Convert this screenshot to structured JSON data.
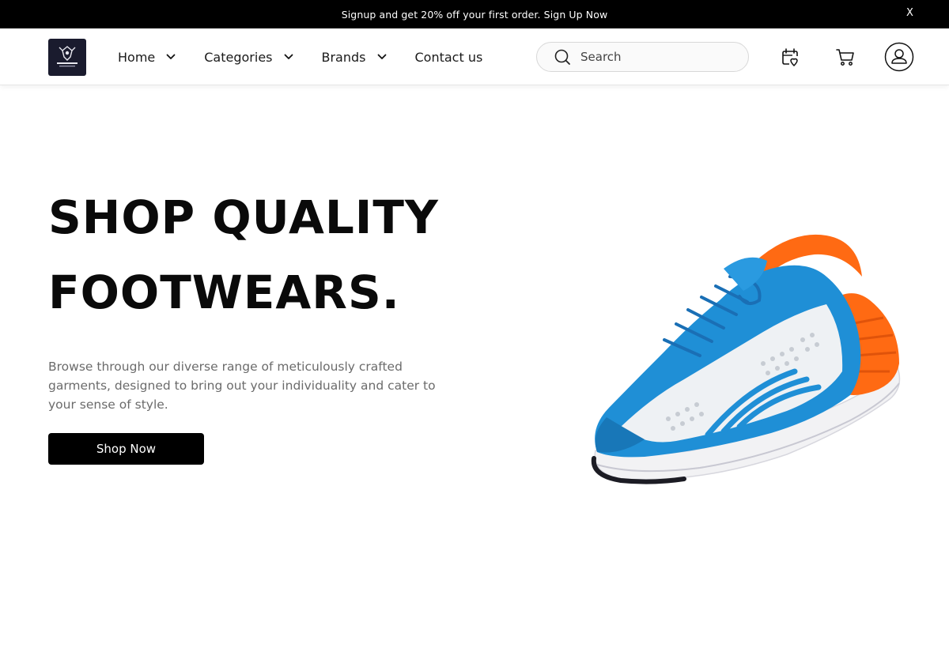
{
  "promo": {
    "text": "Signup and get 20% off your first order.",
    "link": "Sign Up Now",
    "close": "X"
  },
  "nav": {
    "logo_alt": "COAT CLOSURE",
    "items": [
      {
        "label": "Home",
        "has_dropdown": true
      },
      {
        "label": "Categories",
        "has_dropdown": true
      },
      {
        "label": "Brands",
        "has_dropdown": true
      },
      {
        "label": "Contact us",
        "has_dropdown": false
      }
    ],
    "search": {
      "placeholder": "Search",
      "value": ""
    },
    "icons": [
      "wishlist-icon",
      "cart-icon",
      "account-icon"
    ]
  },
  "hero": {
    "title_line1": "SHOP QUALITY",
    "title_line2": "FOOTWEARS.",
    "description": "Browse through our diverse range of meticulously crafted garments, designed to bring out your individuality and cater to your sense of style.",
    "cta": "Shop Now",
    "image": "running-shoe"
  },
  "colors": {
    "promo_bg": "#000000",
    "button_bg": "#000000",
    "shoe_blue": "#1f8fd6",
    "shoe_orange": "#ff6a13"
  }
}
